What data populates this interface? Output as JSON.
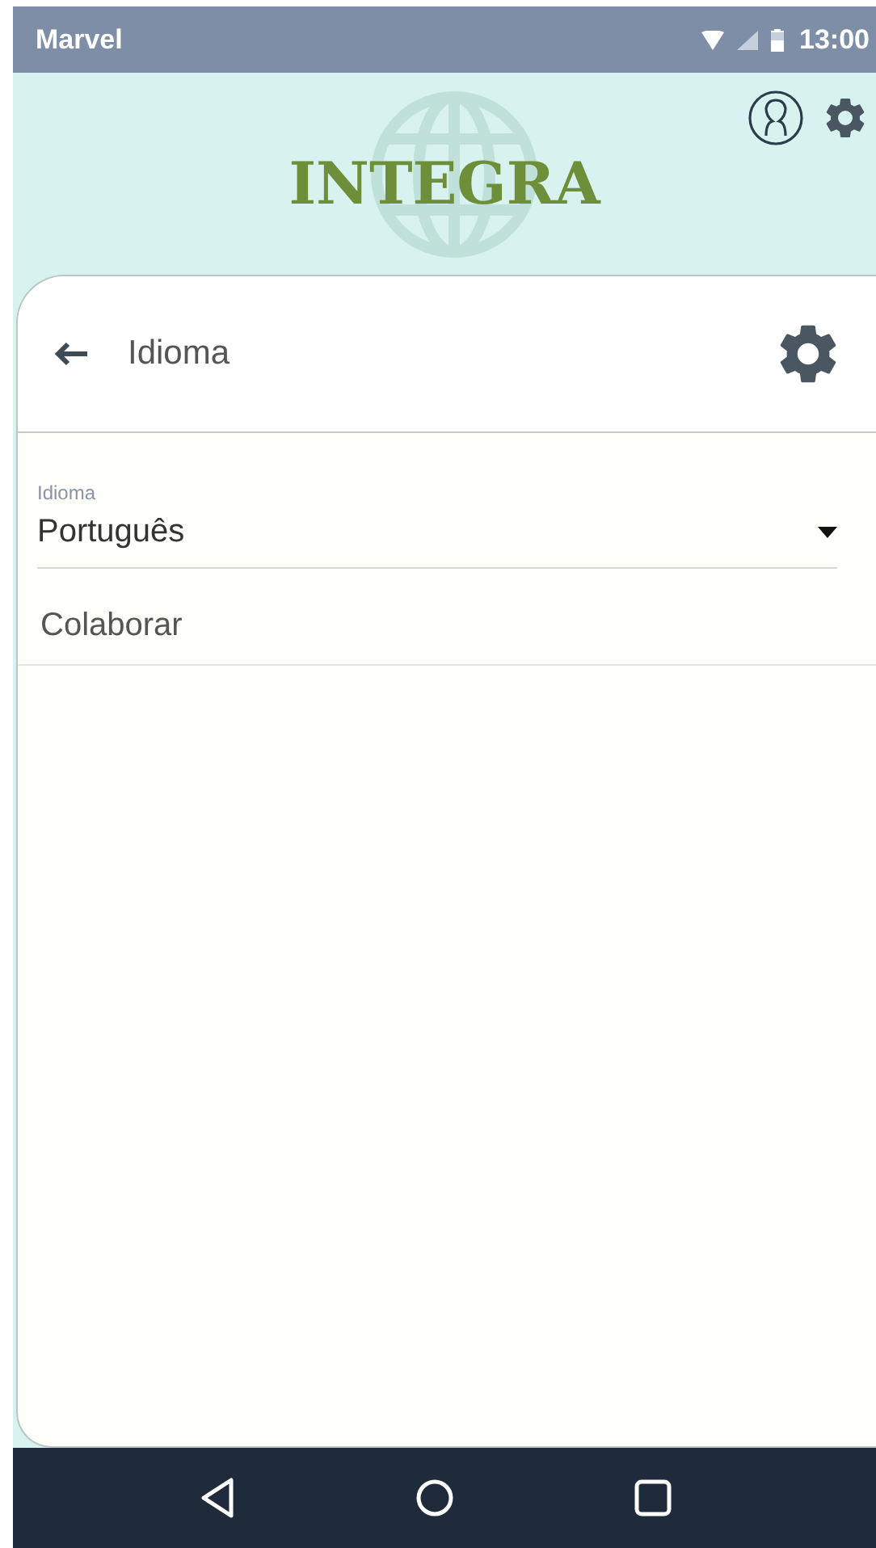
{
  "status_bar": {
    "carrier": "Marvel",
    "time": "13:00"
  },
  "header": {
    "logo": "INTEGRA"
  },
  "card": {
    "title": "Idioma",
    "language_field": {
      "label": "Idioma",
      "value": "Português"
    },
    "items": [
      {
        "label": "Colaborar"
      }
    ]
  }
}
